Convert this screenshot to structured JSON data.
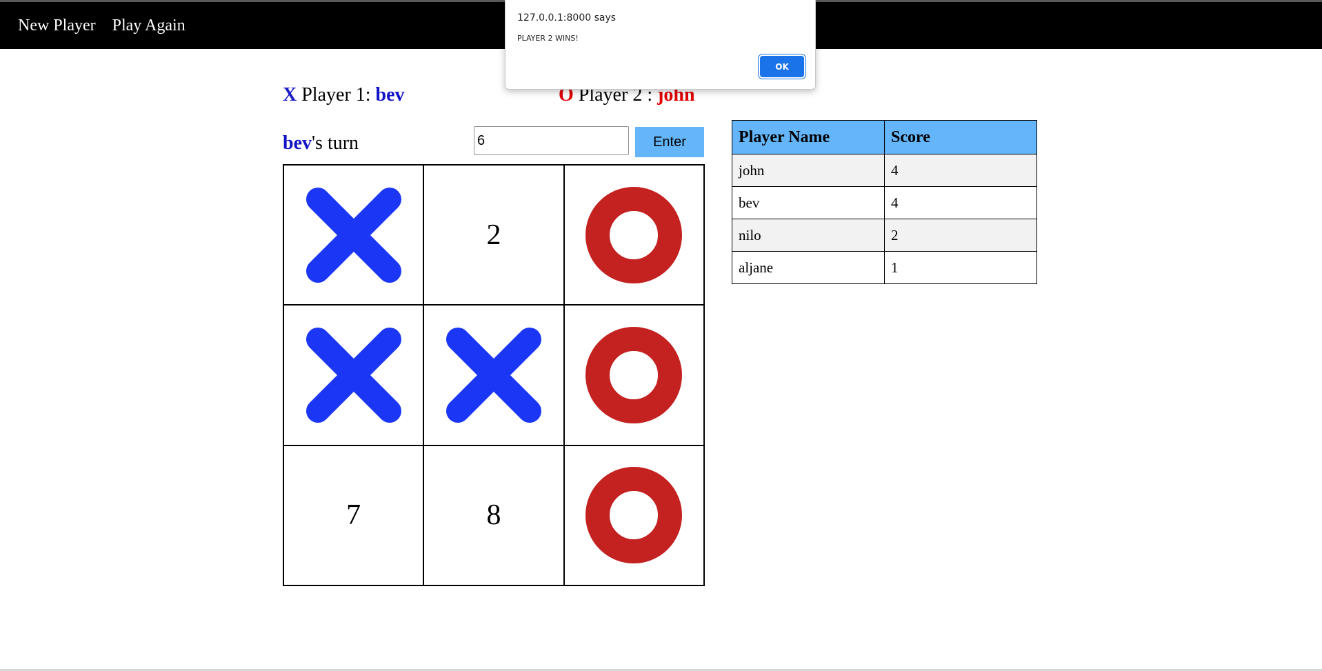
{
  "nav": {
    "new_player": "New Player",
    "play_again": "Play Again"
  },
  "players": {
    "p1_mark": "X",
    "p1_label": " Player 1: ",
    "p1_name": "bev",
    "p2_mark": "O",
    "p2_label": " Player 2 : ",
    "p2_name": "john"
  },
  "turn": {
    "name": "bev",
    "suffix": "'s turn"
  },
  "move_input": {
    "value": "6"
  },
  "enter_label": "Enter",
  "board": {
    "cells": [
      "X",
      "2",
      "O",
      "X",
      "X",
      "O",
      "7",
      "8",
      "O"
    ]
  },
  "scoreboard": {
    "headers": [
      "Player Name",
      "Score"
    ],
    "rows": [
      {
        "name": "john",
        "score": "4"
      },
      {
        "name": "bev",
        "score": "4"
      },
      {
        "name": "nilo",
        "score": "2"
      },
      {
        "name": "aljane",
        "score": "1"
      }
    ]
  },
  "dialog": {
    "title": "127.0.0.1:8000 says",
    "message": "PLAYER 2 WINS!",
    "ok_label": "OK"
  },
  "colors": {
    "x_mark": "#1b36f5",
    "o_mark": "#c42121",
    "player1": "#1212c8",
    "player2": "#e00000",
    "header_bg": "#64b5fa",
    "ok_button": "#1a73e8"
  }
}
